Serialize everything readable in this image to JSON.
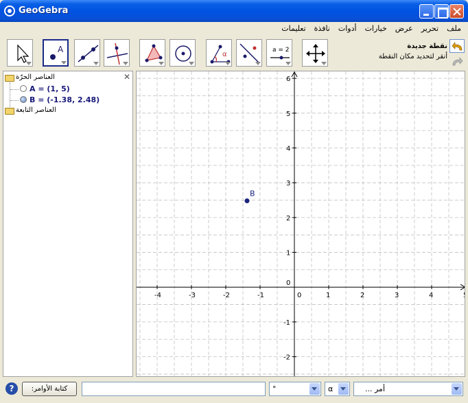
{
  "window": {
    "title": "GeoGebra"
  },
  "menu": [
    "ملف",
    "تحرير",
    "عرض",
    "خيارات",
    "أدوات",
    "نافذة",
    "تعليمات"
  ],
  "toolbar": {
    "tools": [
      "move-tool",
      "new-point-tool",
      "line-tool",
      "perpendicular-tool",
      "polygon-tool",
      "circle-tool",
      "angle-tool",
      "reflect-tool",
      "slider-tool",
      "move-view-tool"
    ],
    "slider_label": "a = 2",
    "selected_tool": "new-point-tool",
    "help_name": "نقطة جديدة",
    "help_text": "أنقر لتحديد مكان النقطة"
  },
  "algebra": {
    "free_label": "العناصر الحرّة",
    "dependent_label": "العناصر التابعة",
    "objects": [
      {
        "text": "A = (1, 5)",
        "filled": false
      },
      {
        "text": "B = (-1.38, 2.48)",
        "filled": true
      }
    ]
  },
  "graphics": {
    "x_range": [
      -4.6,
      5.0
    ],
    "y_range": [
      -2.6,
      6.2
    ],
    "x_ticks": [
      -4,
      -3,
      -2,
      -1,
      0,
      1,
      2,
      3,
      4,
      5
    ],
    "y_ticks": [
      -2,
      -1,
      0,
      1,
      2,
      3,
      4,
      5,
      6
    ],
    "points": [
      {
        "name": "B",
        "x": -1.38,
        "y": 2.48
      }
    ],
    "point_color": "#1a237e"
  },
  "inputbar": {
    "command_button": "كتابة الأوامر:",
    "degree_symbol": "°",
    "alpha_symbol": "α",
    "command_placeholder": "أمر ..."
  }
}
